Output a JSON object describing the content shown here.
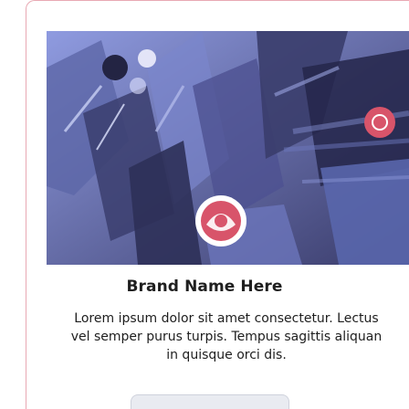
{
  "brand": {
    "name": "Brand Name Here",
    "description_lines": [
      "Lorem ipsum dolor sit amet consectetur. Lectus",
      "vel semper purus turpis. Tempus sagittis aliquan",
      "in quisque orci dis."
    ]
  },
  "cta": {
    "label": ""
  },
  "colors": {
    "accent_border": "#e8a9b3",
    "hero_dark": "#2c2d52",
    "hero_light": "#7d8ad0",
    "logo_badge": "#d8546a",
    "title_text": "#1f1f1f"
  },
  "icons": {
    "hero_image": "hero-photo-image",
    "logo": "brand-logo-icon"
  }
}
